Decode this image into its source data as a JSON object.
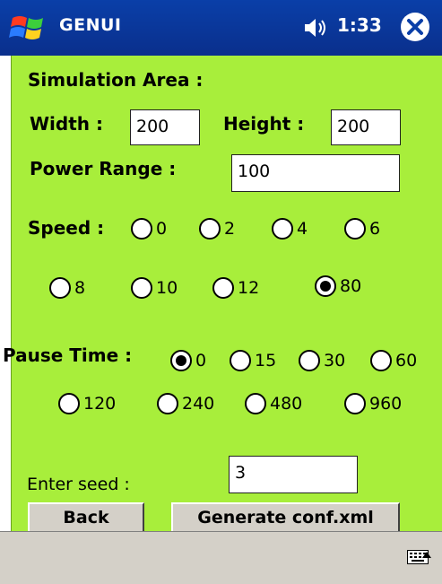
{
  "title_bar": {
    "app_title": "GENUI",
    "time": "1:33",
    "icons": [
      "windows-start-icon",
      "speaker-icon",
      "close-icon"
    ]
  },
  "form": {
    "simulation_area_label": "Simulation Area :",
    "width_label": "Width :",
    "width_value": "200",
    "height_label": "Height :",
    "height_value": "200",
    "power_range_label": "Power Range :",
    "power_range_value": "100",
    "speed_label": "Speed :",
    "speed_options": [
      {
        "label": "0",
        "selected": false
      },
      {
        "label": "2",
        "selected": false
      },
      {
        "label": "4",
        "selected": false
      },
      {
        "label": "6",
        "selected": false
      },
      {
        "label": "8",
        "selected": false
      },
      {
        "label": "10",
        "selected": false
      },
      {
        "label": "12",
        "selected": false
      },
      {
        "label": "80",
        "selected": true
      }
    ],
    "pause_time_label": "Pause Time :",
    "pause_options": [
      {
        "label": "0",
        "selected": true
      },
      {
        "label": "15",
        "selected": false
      },
      {
        "label": "30",
        "selected": false
      },
      {
        "label": "60",
        "selected": false
      },
      {
        "label": "120",
        "selected": false
      },
      {
        "label": "240",
        "selected": false
      },
      {
        "label": "480",
        "selected": false
      },
      {
        "label": "960",
        "selected": false
      }
    ],
    "seed_label": "Enter seed :",
    "seed_value": "3",
    "back_button": "Back",
    "generate_button": "Generate conf.xml"
  },
  "menu_bar": {
    "icons": [
      "keyboard-icon",
      "up-arrow-icon"
    ]
  },
  "colors": {
    "title_bar": "#0a3fa8",
    "form_background": "#a8ee3b",
    "menu_bar": "#d4d0c8"
  }
}
